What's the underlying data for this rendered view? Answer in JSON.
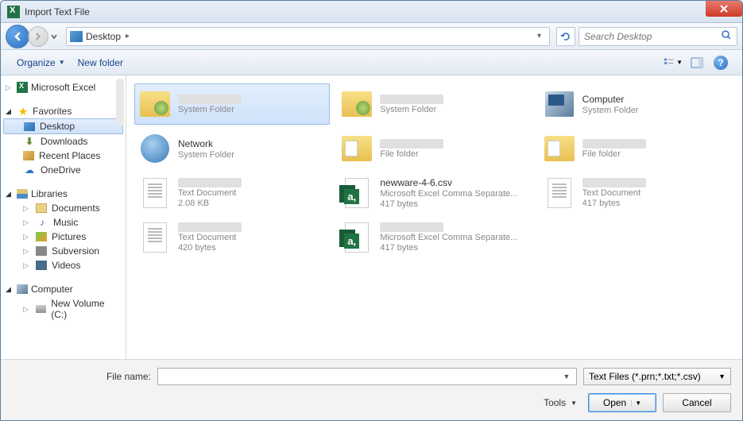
{
  "window": {
    "title": "Import Text File"
  },
  "nav": {
    "location": "Desktop",
    "search_placeholder": "Search Desktop"
  },
  "toolbar": {
    "organize": "Organize",
    "new_folder": "New folder"
  },
  "sidebar": {
    "excel": "Microsoft Excel",
    "favorites": {
      "label": "Favorites",
      "items": [
        {
          "label": "Desktop",
          "icon": "monitor",
          "selected": true
        },
        {
          "label": "Downloads",
          "icon": "download"
        },
        {
          "label": "Recent Places",
          "icon": "recent"
        },
        {
          "label": "OneDrive",
          "icon": "onedrive"
        }
      ]
    },
    "libraries": {
      "label": "Libraries",
      "items": [
        {
          "label": "Documents",
          "icon": "doc-lib"
        },
        {
          "label": "Music",
          "icon": "music"
        },
        {
          "label": "Pictures",
          "icon": "pic"
        },
        {
          "label": "Subversion",
          "icon": "svn"
        },
        {
          "label": "Videos",
          "icon": "video"
        }
      ]
    },
    "computer": {
      "label": "Computer",
      "items": [
        {
          "label": "New Volume (C:)",
          "icon": "drive"
        }
      ]
    }
  },
  "files": [
    {
      "name_hidden": true,
      "type": "System Folder",
      "icon": "folder-user",
      "selected": true
    },
    {
      "name_hidden": true,
      "type": "System Folder",
      "icon": "folder-user"
    },
    {
      "name": "Computer",
      "type": "System Folder",
      "icon": "computer"
    },
    {
      "name": "Network",
      "type": "System Folder",
      "icon": "network"
    },
    {
      "name_hidden": true,
      "type": "File folder",
      "icon": "folder-plain"
    },
    {
      "name_hidden": true,
      "type": "File folder",
      "icon": "folder-plain"
    },
    {
      "name_hidden": true,
      "type": "Text Document",
      "size": "2.08 KB",
      "icon": "txt"
    },
    {
      "name": "newware-4-6.csv",
      "type": "Microsoft Excel Comma Separate...",
      "size": "417 bytes",
      "icon": "xls"
    },
    {
      "name_hidden": true,
      "type": "Text Document",
      "size": "417 bytes",
      "icon": "txt"
    },
    {
      "name_hidden": true,
      "type": "Text Document",
      "size": "420 bytes",
      "icon": "txt"
    },
    {
      "name_hidden": true,
      "type": "Microsoft Excel Comma Separate...",
      "size": "417 bytes",
      "icon": "xls"
    }
  ],
  "footer": {
    "filename_label": "File name:",
    "filename_value": "",
    "filter": "Text Files (*.prn;*.txt;*.csv)",
    "tools": "Tools",
    "open": "Open",
    "cancel": "Cancel"
  }
}
